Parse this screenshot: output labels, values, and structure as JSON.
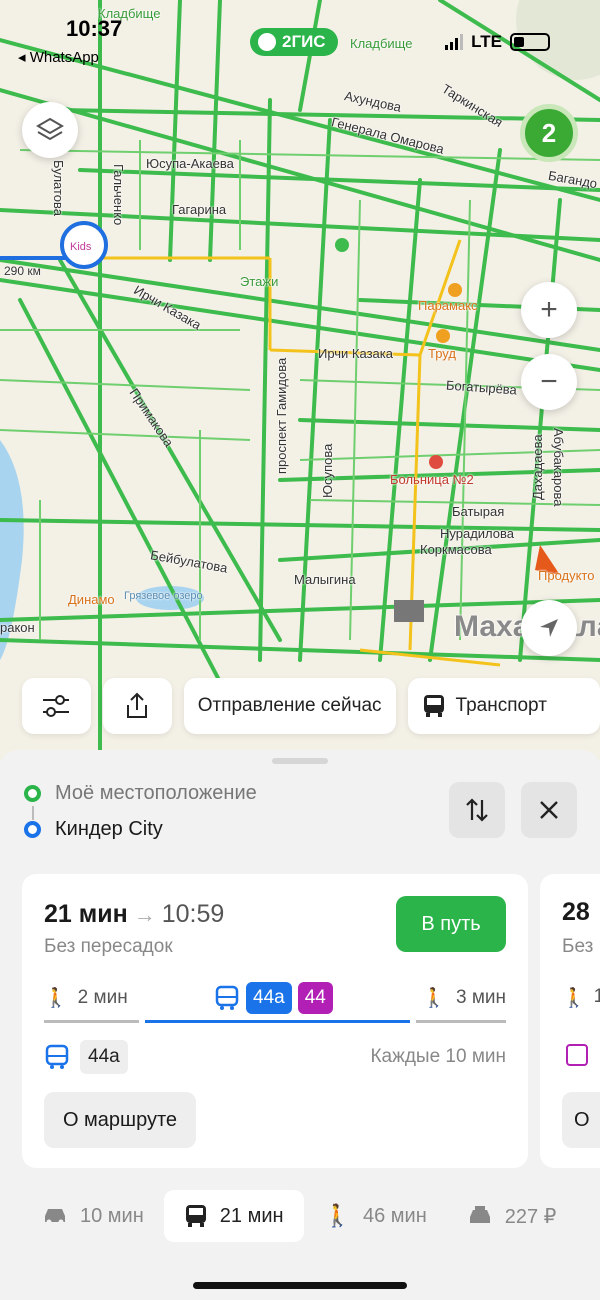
{
  "status": {
    "time": "10:37",
    "back_app": "◂ WhatsApp",
    "network": "LTE"
  },
  "map": {
    "logo": "2ГИС",
    "traffic_badge": "2",
    "zoom_in": "+",
    "zoom_out": "−",
    "distance_label": "290 км",
    "city_label": "Махачкала",
    "streets": {
      "kladbishche_top": "Кладбище",
      "kladbishche_right": "Кладбище",
      "akhundova": "Ахундова",
      "tarkinskaya": "Таркинская",
      "generala_omarova": "Генерала Омарова",
      "bagandova": "Багандо",
      "yusupa_akaeva": "Юсупа-Акаева",
      "bulatova": "Булатова",
      "galchenko": "Гальченко",
      "gagarina": "Гагарина",
      "etazhi": "Этажи",
      "irchi_kazaka_1": "Ирчи Казака",
      "irchi_kazaka_2": "Ирчи Казака",
      "paramaks": "Парамакс",
      "trud": "Труд",
      "bogatyreva": "Богатырёва",
      "prospekt_gamidova": "проспект Гамидова",
      "primakova": "Примакова",
      "yusupova": "Юсупова",
      "bolnitsa": "Больница №2",
      "dakhadaeva": "Дахадаева",
      "abubakarova": "Абубакарова",
      "batyraya": "Батырая",
      "nuradilova": "Нурадилова",
      "korkmasova": "Коркмасова",
      "produkty": "Продукто",
      "beybulatova": "Бейбулатова",
      "dinamo": "Динамо",
      "gryazevoe": "Грязевое озеро",
      "maligina": "Малыгина",
      "rakon": "ракон"
    }
  },
  "controls": {
    "filter_icon": "sliders-icon",
    "share_icon": "share-icon",
    "departure": "Отправление сейчас",
    "transport": "Транспорт"
  },
  "route": {
    "from": "Моё местоположение",
    "to": "Киндер City",
    "from_color": "#2bb44a",
    "to_color": "#1a73e8"
  },
  "card": {
    "duration": "21 мин",
    "arrival": "10:59",
    "transfers": "Без пересадок",
    "go_button": "В путь",
    "walk_before": "2 мин",
    "walk_after": "3 мин",
    "bus_tags": [
      "44а",
      "44"
    ],
    "bus_tag_colors": [
      "#1a73e8",
      "#b21fb5"
    ],
    "bus_progress": [
      {
        "segment": "walk",
        "share": 0.21
      },
      {
        "segment": "bus",
        "share": 0.59
      },
      {
        "segment": "walk",
        "share": 0.2
      }
    ],
    "line_tag": "44а",
    "frequency": "Каждые 10 мин",
    "route_button": "О маршруте"
  },
  "card2": {
    "duration": "28",
    "transfers": "Без",
    "walk": "1",
    "route_button": "О"
  },
  "modes": [
    {
      "icon": "car-icon",
      "label": "10 мин",
      "active": false
    },
    {
      "icon": "bus-icon",
      "label": "21 мин",
      "active": true
    },
    {
      "icon": "walk-icon",
      "label": "46 мин",
      "active": false
    },
    {
      "icon": "taxi-icon",
      "label": "227 ₽",
      "active": false
    }
  ]
}
